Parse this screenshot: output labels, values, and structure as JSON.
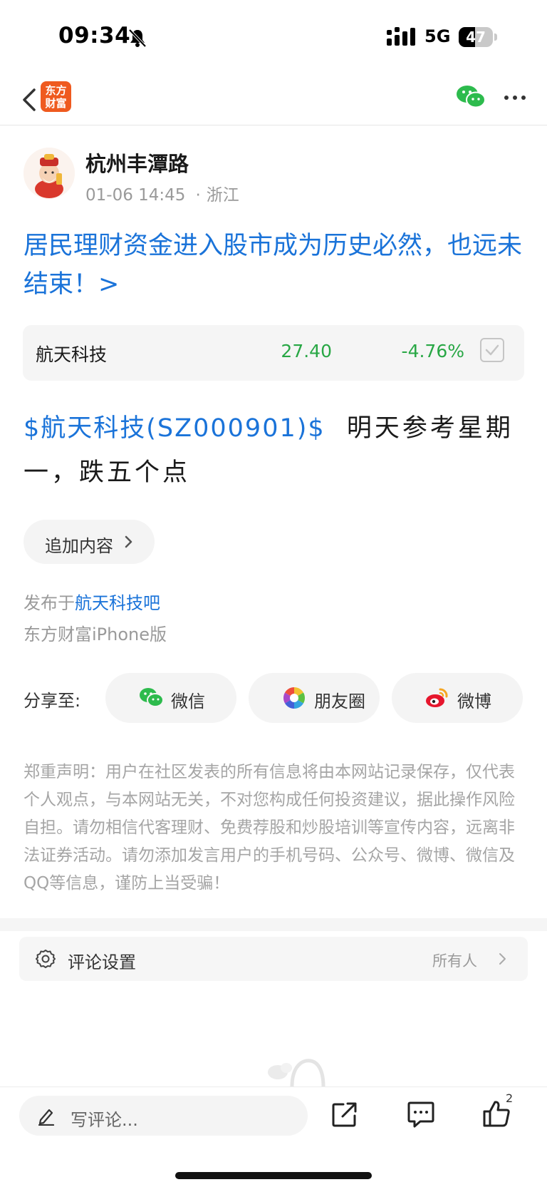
{
  "status_bar": {
    "time": "09:34",
    "network": "5G",
    "battery_level": 47,
    "battery_text": "47"
  },
  "nav": {
    "logo_text_line1": "东方",
    "logo_text_line2": "财富",
    "brand_color": "#ef5a1f",
    "wechat_color": "#2dbb4d"
  },
  "post": {
    "author": "杭州丰潭路",
    "datetime": "01-06 14:45",
    "location": "浙江",
    "headline": "居民理财资金进入股市成为历史必然，也远未结束！>",
    "stock_card": {
      "name": "航天科技",
      "price": "27.40",
      "change": "-4.76%",
      "color": "#28a745"
    },
    "body_stock_tag": "$航天科技(SZ000901)$",
    "body_text": "明天参考星期一，跌五个点",
    "append_label": "追加内容",
    "published_prefix": "发布于",
    "published_bar": "航天科技吧",
    "client": "东方财富iPhone版"
  },
  "share": {
    "label": "分享至:",
    "buttons": [
      {
        "label": "微信",
        "icon": "wechat-icon"
      },
      {
        "label": "朋友圈",
        "icon": "moments-icon"
      },
      {
        "label": "微博",
        "icon": "weibo-icon"
      }
    ]
  },
  "disclaimer": "郑重声明：用户在社区发表的所有信息将由本网站记录保存，仅代表个人观点，与本网站无关，不对您构成任何投资建议，据此操作风险自担。请勿相信代客理财、免费荐股和炒股培训等宣传内容，远离非法证券活动。请勿添加发言用户的手机号码、公众号、微博、微信及QQ等信息，谨防上当受骗！",
  "comment_settings": {
    "label": "评论设置",
    "value": "所有人"
  },
  "bottom_bar": {
    "placeholder": "写评论...",
    "like_count": "2"
  },
  "colors": {
    "link": "#1a73d9",
    "down": "#28a745"
  }
}
